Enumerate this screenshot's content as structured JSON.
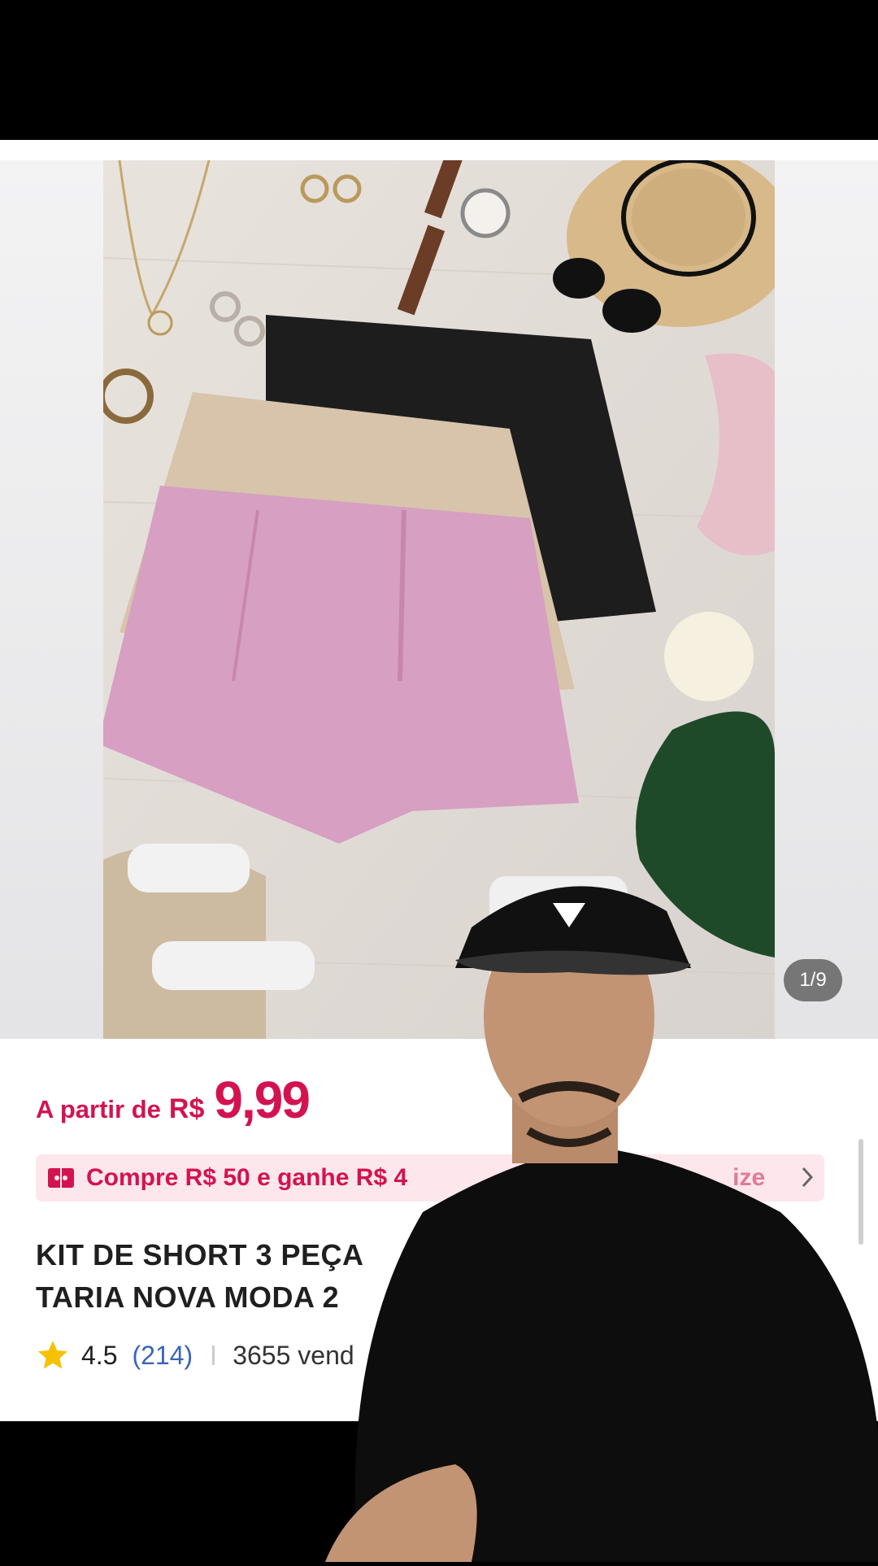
{
  "gallery": {
    "page_indicator": "1/9"
  },
  "product": {
    "price_prefix": "A partir de",
    "price_currency": "R$",
    "price_value": "9,99",
    "promo_text": "Compre R$ 50 e ganhe R$ 4",
    "promo_text_right": "ize",
    "title": "KIT DE SHORT 3 PEÇA\nTARIA NOVA MODA 2",
    "rating": "4.5",
    "review_count": "(214)",
    "sold_text": "3655 vend"
  },
  "colors": {
    "accent": "#d3134f",
    "promo_bg": "#fde7ec",
    "link_blue": "#3b64b8",
    "star": "#f5c100"
  },
  "icons": {
    "promo": "coupon-icon",
    "chevron": "chevron-right-icon",
    "rating": "star-icon"
  }
}
